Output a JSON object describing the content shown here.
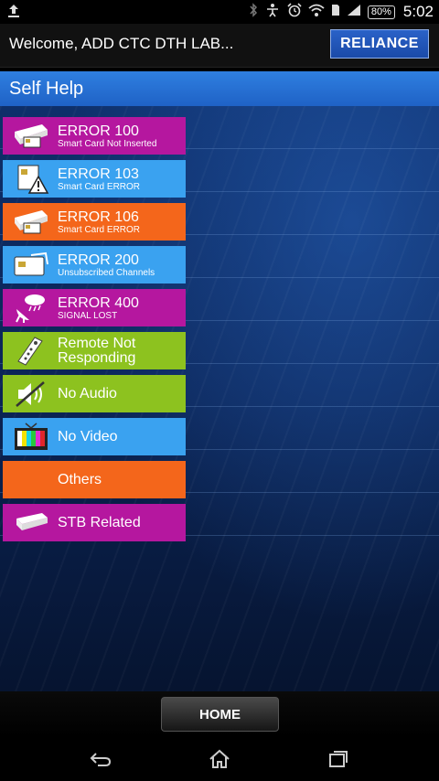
{
  "status_bar": {
    "battery_percent": "80%",
    "time": "5:02",
    "icons": [
      "upload-icon",
      "bluetooth-icon",
      "accessibility-icon",
      "alarm-icon",
      "wifi-icon",
      "sim-icon",
      "signal-icon",
      "battery-icon"
    ]
  },
  "header": {
    "welcome": "Welcome, ADD CTC DTH LAB...",
    "logo_text": "RELIANCE"
  },
  "title_bar": {
    "title": "Self Help"
  },
  "menu": [
    {
      "title": "ERROR 100",
      "subtitle": "Smart Card Not Inserted",
      "color": "#b5179f",
      "icon": "stb-card-icon"
    },
    {
      "title": "ERROR 103",
      "subtitle": "Smart Card ERROR",
      "color": "#3aa2f0",
      "icon": "smartcard-warning-icon"
    },
    {
      "title": "ERROR 106",
      "subtitle": "Smart Card ERROR",
      "color": "#f4661b",
      "icon": "stb-card-icon"
    },
    {
      "title": "ERROR 200",
      "subtitle": "Unsubscribed  Channels",
      "color": "#3aa2f0",
      "icon": "card-icon"
    },
    {
      "title": "ERROR 400",
      "subtitle": "SIGNAL  LOST",
      "color": "#b5179f",
      "icon": "dish-cloud-icon"
    },
    {
      "title": "Remote Not\nResponding",
      "subtitle": "",
      "color": "#8dc21f",
      "icon": "remote-icon"
    },
    {
      "title": "No Audio",
      "subtitle": "",
      "color": "#8dc21f",
      "icon": "mute-icon"
    },
    {
      "title": "No Video",
      "subtitle": "",
      "color": "#3aa2f0",
      "icon": "tv-icon"
    },
    {
      "title": "Others",
      "subtitle": "",
      "color": "#f4661b",
      "icon": ""
    },
    {
      "title": "STB Related",
      "subtitle": "",
      "color": "#b5179f",
      "icon": "stb-icon"
    }
  ],
  "bottom": {
    "home_label": "HOME"
  },
  "nav": {
    "buttons": [
      "back-icon",
      "home-icon",
      "recents-icon"
    ]
  }
}
